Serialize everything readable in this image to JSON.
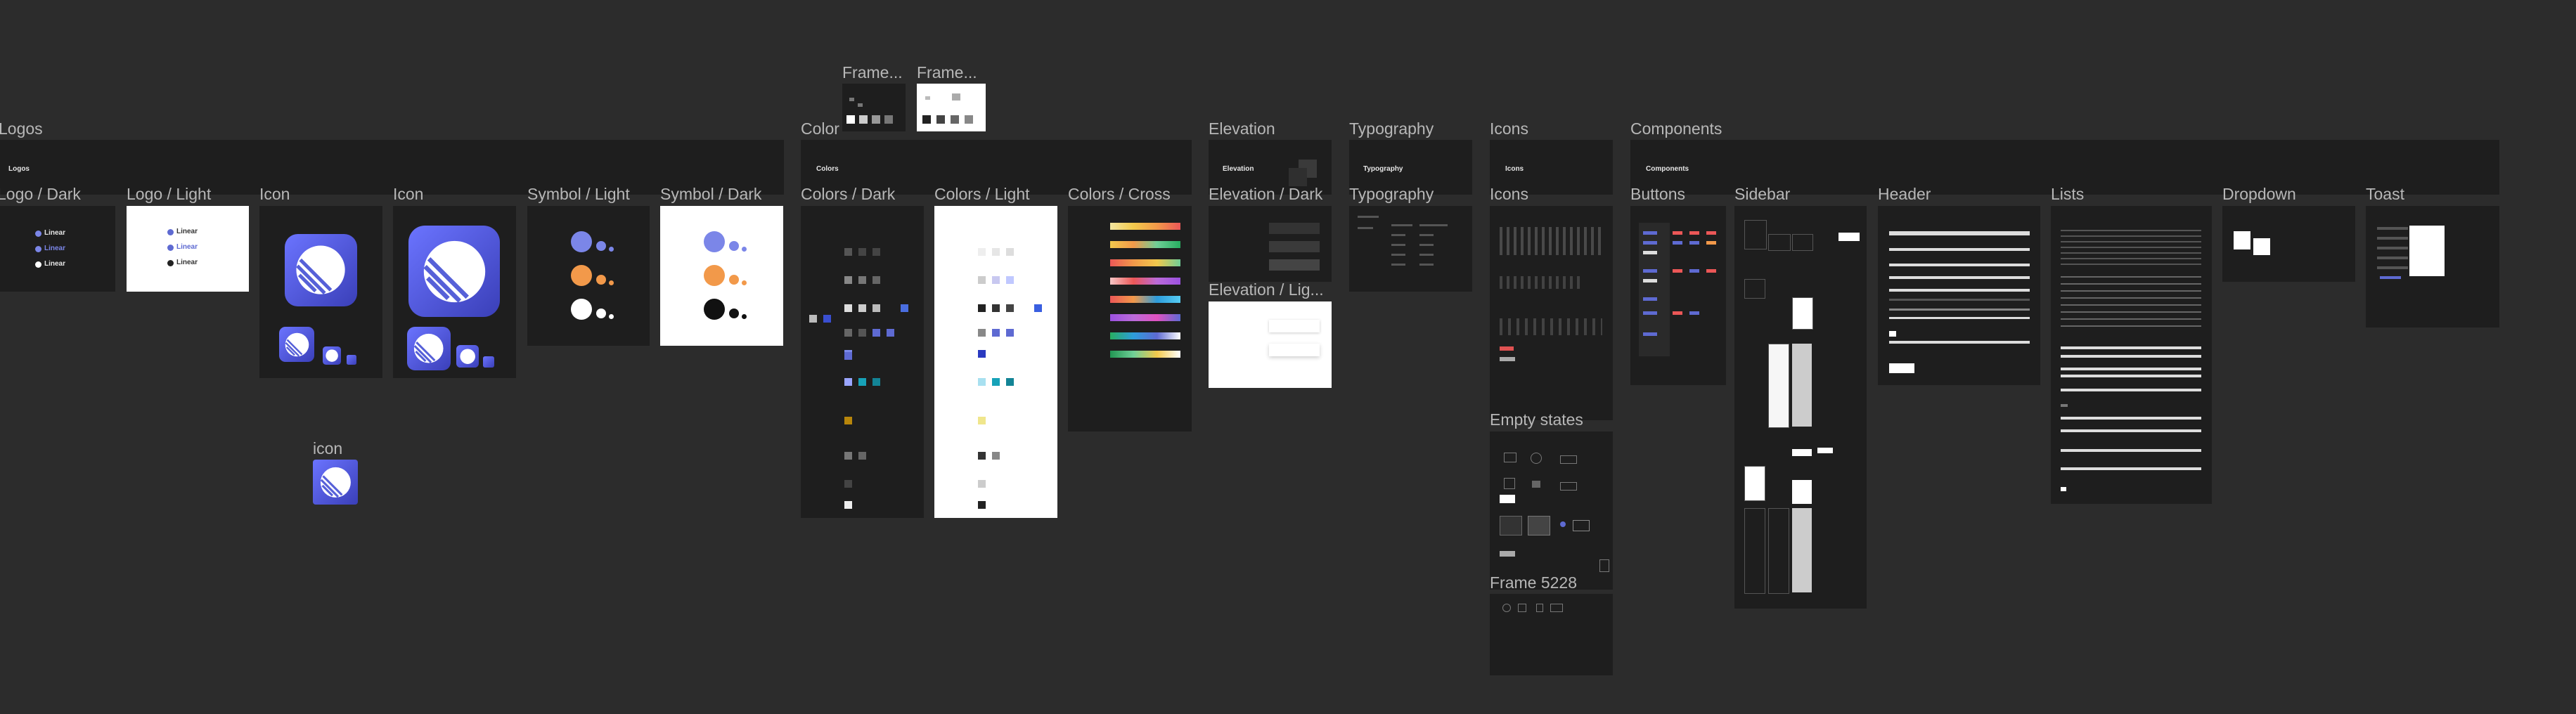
{
  "frames": {
    "frame_1": "Frame...",
    "frame_2": "Frame...",
    "logos": "Logos",
    "logo_dark": "Logo / Dark",
    "logo_light": "Logo / Light",
    "icon_1": "Icon",
    "icon_2": "Icon",
    "symbol_light": "Symbol / Light",
    "symbol_dark": "Symbol / Dark",
    "icon_small": "icon",
    "color": "Color",
    "colors_dark": "Colors / Dark",
    "colors_light": "Colors / Light",
    "colors_cross": "Colors / Cross",
    "elevation": "Elevation",
    "elevation_dark": "Elevation / Dark",
    "elevation_light": "Elevation / Lig...",
    "typography_section": "Typography",
    "typography": "Typography",
    "icons_section": "Icons",
    "icons": "Icons",
    "empty_states": "Empty states",
    "frame_5228": "Frame 5228",
    "components": "Components",
    "buttons": "Buttons",
    "sidebar": "Sidebar",
    "header": "Header",
    "lists": "Lists",
    "dropdown": "Dropdown",
    "toast": "Toast"
  },
  "banners": {
    "logos": "Logos",
    "colors": "Colors",
    "elevation": "Elevation",
    "typography": "Typography",
    "icons": "Icons",
    "components": "Components"
  },
  "logo_word": "Linear",
  "colors": {
    "banner_bg": "#1e1e1e",
    "canvas_bg": "#2c2c2c",
    "frame_dark": "#1e1e1e",
    "brand": "#5e6ad2",
    "orange": "#f2994a"
  }
}
